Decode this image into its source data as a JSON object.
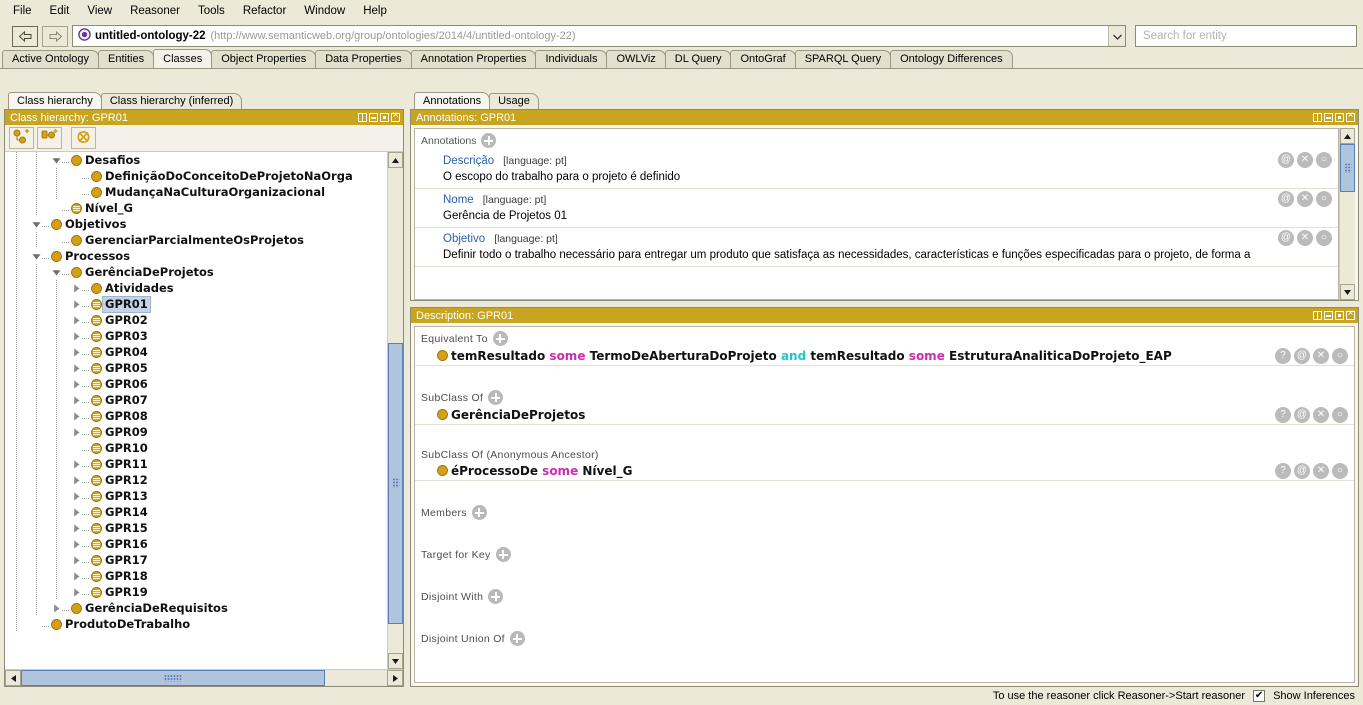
{
  "menu": {
    "items": [
      "File",
      "Edit",
      "View",
      "Reasoner",
      "Tools",
      "Refactor",
      "Window",
      "Help"
    ]
  },
  "toolbar": {
    "back_icon": "back-arrow-icon",
    "forward_icon": "forward-arrow-icon",
    "ontology_icon": "ontology-icon",
    "ontology_name": "untitled-ontology-22",
    "ontology_iri": "(http://www.semanticweb.org/group/ontologies/2014/4/untitled-ontology-22)",
    "dropdown_icon": "chevron-down-icon",
    "search_placeholder": "Search for entity",
    "search_value": ""
  },
  "main_tabs": [
    {
      "label": "Active Ontology",
      "active": false
    },
    {
      "label": "Entities",
      "active": false
    },
    {
      "label": "Classes",
      "active": true
    },
    {
      "label": "Object Properties",
      "active": false
    },
    {
      "label": "Data Properties",
      "active": false
    },
    {
      "label": "Annotation Properties",
      "active": false
    },
    {
      "label": "Individuals",
      "active": false
    },
    {
      "label": "OWLViz",
      "active": false
    },
    {
      "label": "DL Query",
      "active": false
    },
    {
      "label": "OntoGraf",
      "active": false
    },
    {
      "label": "SPARQL Query",
      "active": false
    },
    {
      "label": "Ontology Differences",
      "active": false
    }
  ],
  "left_panel": {
    "tabs": [
      {
        "label": "Class hierarchy",
        "active": true
      },
      {
        "label": "Class hierarchy (inferred)",
        "active": false
      }
    ],
    "header_title": "Class hierarchy: GPR01",
    "toolbar_buttons": [
      {
        "name": "add-subclass-button",
        "title": "Add subclass"
      },
      {
        "name": "add-sibling-class-button",
        "title": "Add sibling class"
      },
      {
        "name": "delete-class-button",
        "title": "Delete selected class"
      }
    ],
    "tree": [
      {
        "label": "Desafios",
        "depth": 3,
        "icon": "class-icon",
        "twist": "open",
        "selected": false
      },
      {
        "label": "DefiniçãoDoConceitoDeProjetoNaOrga",
        "depth": 4,
        "icon": "class-icon",
        "twist": "leaf",
        "selected": false
      },
      {
        "label": "MudançaNaCulturaOrganizacional",
        "depth": 4,
        "icon": "class-icon",
        "twist": "leaf",
        "selected": false
      },
      {
        "label": "Nível_G",
        "depth": 3,
        "icon": "defined-class-icon",
        "twist": "leaf",
        "selected": false
      },
      {
        "label": "Objetivos",
        "depth": 2,
        "icon": "class-icon",
        "twist": "open",
        "selected": false
      },
      {
        "label": "GerenciarParcialmenteOsProjetos",
        "depth": 3,
        "icon": "class-icon",
        "twist": "leaf",
        "selected": false
      },
      {
        "label": "Processos",
        "depth": 2,
        "icon": "class-icon",
        "twist": "open",
        "selected": false
      },
      {
        "label": "GerênciaDeProjetos",
        "depth": 3,
        "icon": "class-icon",
        "twist": "open",
        "selected": false
      },
      {
        "label": "Atividades",
        "depth": 4,
        "icon": "class-icon",
        "twist": "closed",
        "selected": false
      },
      {
        "label": "GPR01",
        "depth": 4,
        "icon": "defined-class-icon",
        "twist": "closed",
        "selected": true
      },
      {
        "label": "GPR02",
        "depth": 4,
        "icon": "defined-class-icon",
        "twist": "closed",
        "selected": false
      },
      {
        "label": "GPR03",
        "depth": 4,
        "icon": "defined-class-icon",
        "twist": "closed",
        "selected": false
      },
      {
        "label": "GPR04",
        "depth": 4,
        "icon": "defined-class-icon",
        "twist": "closed",
        "selected": false
      },
      {
        "label": "GPR05",
        "depth": 4,
        "icon": "defined-class-icon",
        "twist": "closed",
        "selected": false
      },
      {
        "label": "GPR06",
        "depth": 4,
        "icon": "defined-class-icon",
        "twist": "closed",
        "selected": false
      },
      {
        "label": "GPR07",
        "depth": 4,
        "icon": "defined-class-icon",
        "twist": "closed",
        "selected": false
      },
      {
        "label": "GPR08",
        "depth": 4,
        "icon": "defined-class-icon",
        "twist": "closed",
        "selected": false
      },
      {
        "label": "GPR09",
        "depth": 4,
        "icon": "defined-class-icon",
        "twist": "closed",
        "selected": false
      },
      {
        "label": "GPR10",
        "depth": 4,
        "icon": "defined-class-icon",
        "twist": "leaf",
        "selected": false
      },
      {
        "label": "GPR11",
        "depth": 4,
        "icon": "defined-class-icon",
        "twist": "closed",
        "selected": false
      },
      {
        "label": "GPR12",
        "depth": 4,
        "icon": "defined-class-icon",
        "twist": "closed",
        "selected": false
      },
      {
        "label": "GPR13",
        "depth": 4,
        "icon": "defined-class-icon",
        "twist": "closed",
        "selected": false
      },
      {
        "label": "GPR14",
        "depth": 4,
        "icon": "defined-class-icon",
        "twist": "closed",
        "selected": false
      },
      {
        "label": "GPR15",
        "depth": 4,
        "icon": "defined-class-icon",
        "twist": "closed",
        "selected": false
      },
      {
        "label": "GPR16",
        "depth": 4,
        "icon": "defined-class-icon",
        "twist": "closed",
        "selected": false
      },
      {
        "label": "GPR17",
        "depth": 4,
        "icon": "defined-class-icon",
        "twist": "closed",
        "selected": false
      },
      {
        "label": "GPR18",
        "depth": 4,
        "icon": "defined-class-icon",
        "twist": "closed",
        "selected": false
      },
      {
        "label": "GPR19",
        "depth": 4,
        "icon": "defined-class-icon",
        "twist": "closed",
        "selected": false
      },
      {
        "label": "GerênciaDeRequisitos",
        "depth": 3,
        "icon": "class-icon",
        "twist": "closed",
        "selected": false
      },
      {
        "label": "ProdutoDeTrabalho",
        "depth": 2,
        "icon": "class-icon",
        "twist": "leaf",
        "selected": false
      }
    ]
  },
  "annotations_panel": {
    "tabs": [
      {
        "label": "Annotations",
        "active": true
      },
      {
        "label": "Usage",
        "active": false
      }
    ],
    "header_title": "Annotations: GPR01",
    "section_label": "Annotations",
    "add_icon": "plus-icon",
    "row_icons": [
      "at-icon",
      "delete-icon",
      "edit-icon"
    ],
    "rows": [
      {
        "property": "Descrição",
        "lang": "[language: pt]",
        "value": "O escopo do trabalho para o projeto é definido"
      },
      {
        "property": "Nome",
        "lang": "[language: pt]",
        "value": "Gerência de Projetos 01"
      },
      {
        "property": "Objetivo",
        "lang": "[language: pt]",
        "value": "Definir todo o trabalho necessário para entregar um produto que satisfaça as necessidades, características e funções especificadas para o projeto, de forma a"
      }
    ]
  },
  "description_panel": {
    "header_title": "Description: GPR01",
    "add_icon": "plus-icon",
    "row_icons": [
      "help-icon",
      "at-icon",
      "delete-icon",
      "edit-icon"
    ],
    "sections": [
      {
        "label": "Equivalent To",
        "has_add": true,
        "axioms": [
          {
            "icon": "class-icon",
            "tokens": [
              {
                "t": "temResultado",
                "k": "ent"
              },
              {
                "t": "some",
                "k": "kw"
              },
              {
                "t": "TermoDeAberturaDoProjeto",
                "k": "ent"
              },
              {
                "t": "and",
                "k": "kw2"
              },
              {
                "t": "temResultado",
                "k": "ent"
              },
              {
                "t": "some",
                "k": "kw"
              },
              {
                "t": "EstruturaAnaliticaDoProjeto_EAP",
                "k": "ent"
              }
            ]
          }
        ]
      },
      {
        "label": "SubClass Of",
        "has_add": true,
        "axioms": [
          {
            "icon": "class-icon",
            "tokens": [
              {
                "t": "GerênciaDeProjetos",
                "k": "ent"
              }
            ]
          }
        ]
      },
      {
        "label": "SubClass Of (Anonymous Ancestor)",
        "has_add": false,
        "axioms": [
          {
            "icon": "class-icon",
            "tokens": [
              {
                "t": "éProcessoDe",
                "k": "ent"
              },
              {
                "t": "some",
                "k": "kw"
              },
              {
                "t": "Nível_G",
                "k": "ent"
              }
            ]
          }
        ]
      },
      {
        "label": "Members",
        "has_add": true,
        "axioms": []
      },
      {
        "label": "Target for Key",
        "has_add": true,
        "axioms": []
      },
      {
        "label": "Disjoint With",
        "has_add": true,
        "axioms": []
      },
      {
        "label": "Disjoint Union Of",
        "has_add": true,
        "axioms": []
      }
    ]
  },
  "status_bar": {
    "message": "To use the reasoner click Reasoner->Start reasoner",
    "checkbox_label": "Show Inferences",
    "checkbox_checked": true
  },
  "colors": {
    "panel_header": "#c8a521",
    "class_icon": "#d4a017",
    "keyword_some": "#cf2bb0",
    "keyword_and": "#21c5d4",
    "property_link": "#2b5fa8",
    "selection": "#c4d3e8",
    "window_bg": "#ece9d8"
  }
}
